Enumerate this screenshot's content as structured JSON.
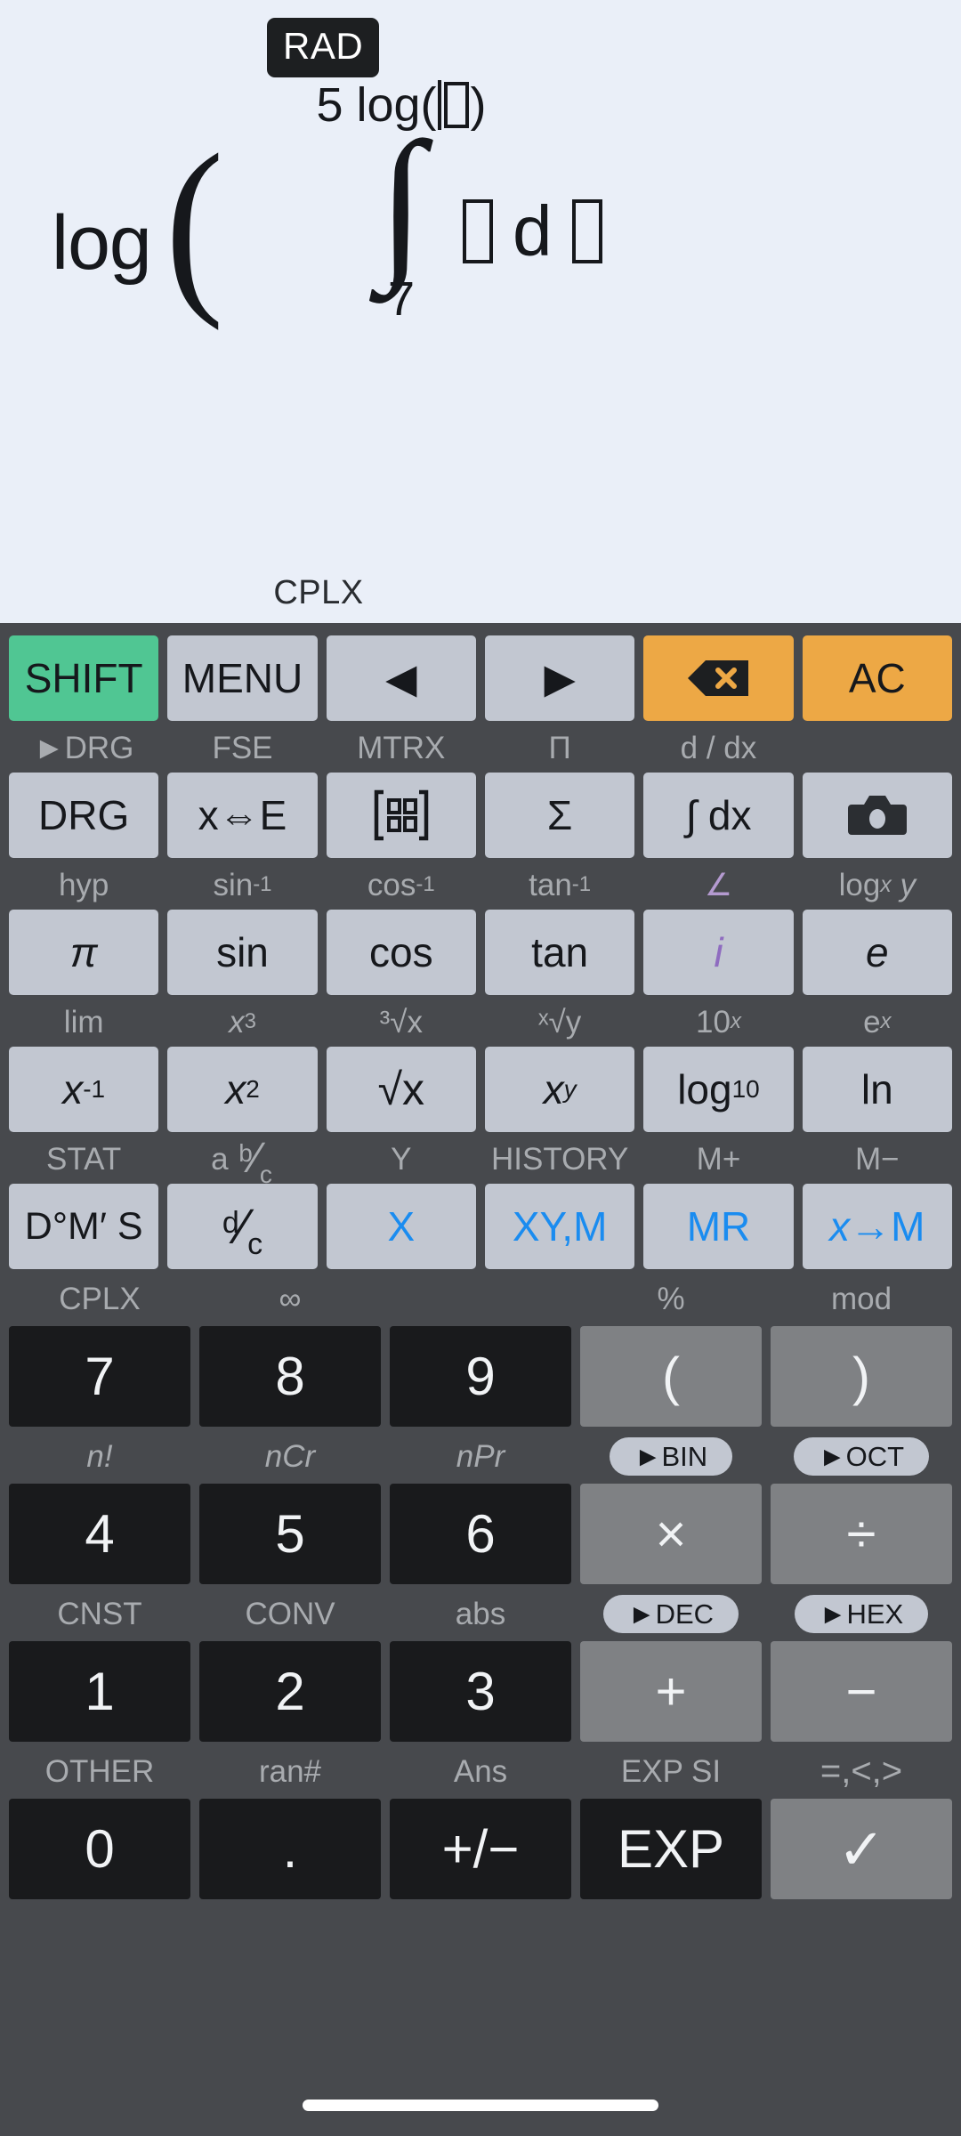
{
  "display": {
    "angle_mode_badge": "RAD",
    "formula": {
      "outer_function": "log",
      "open_paren": "(",
      "integral_upper_limit_prefix": "5 log(",
      "integral_upper_limit_suffix": ")",
      "integral_symbol": "∫",
      "integral_lower_limit": "7",
      "differential": "d"
    },
    "mode_note": "CPLX"
  },
  "keypad": {
    "row1": {
      "buttons": [
        {
          "label": "SHIFT",
          "style": "green"
        },
        {
          "label": "MENU",
          "style": "normal"
        },
        {
          "label": "◀",
          "style": "normal"
        },
        {
          "label": "▶",
          "style": "normal"
        },
        {
          "label": "",
          "style": "orange",
          "icon": "backspace-icon"
        },
        {
          "label": "AC",
          "style": "orange"
        }
      ]
    },
    "row2": {
      "labels": [
        "►DRG",
        "FSE",
        "MTRX",
        "Π",
        "d / dx",
        ""
      ],
      "buttons": [
        {
          "label": "DRG"
        },
        {
          "label": "x⇔E"
        },
        {
          "label": "",
          "icon": "matrix-icon"
        },
        {
          "label": "Σ"
        },
        {
          "label": "∫ dx"
        },
        {
          "label": "",
          "icon": "camera-icon"
        }
      ]
    },
    "row3": {
      "labels": [
        "hyp",
        "sin",
        "cos",
        "tan",
        "∠",
        "log"
      ],
      "label_sups": [
        "",
        "-1",
        "-1",
        "-1",
        "",
        ""
      ],
      "label_extra": [
        "",
        "",
        "",
        "",
        "",
        "x y"
      ],
      "buttons": [
        {
          "label": "π"
        },
        {
          "label": "sin"
        },
        {
          "label": "cos"
        },
        {
          "label": "tan"
        },
        {
          "label": "i"
        },
        {
          "label": "e"
        }
      ]
    },
    "row4": {
      "labels": [
        "lim",
        "x",
        "³√x",
        "ˣ√y",
        "10",
        "e"
      ],
      "label_sups": [
        "",
        "3",
        "",
        "",
        "x",
        "x"
      ],
      "buttons": [
        {
          "label": "x",
          "sup": "-1"
        },
        {
          "label": "x",
          "sup": "2"
        },
        {
          "label": "√x"
        },
        {
          "label": "x",
          "sup": "y"
        },
        {
          "label": "log",
          "sub": "10"
        },
        {
          "label": "ln"
        }
      ]
    },
    "row5": {
      "labels": [
        "STAT",
        "a b/c",
        "Y",
        "HISTORY",
        "M+",
        "M−"
      ],
      "buttons": [
        {
          "label": "D°M′ S"
        },
        {
          "label": "d/c"
        },
        {
          "label": "X",
          "style": "blue"
        },
        {
          "label": "XY,M",
          "style": "blue"
        },
        {
          "label": "MR",
          "style": "blue"
        },
        {
          "label": "x→M",
          "style": "blue"
        }
      ]
    }
  },
  "numpad": {
    "rows": [
      {
        "labels": [
          "CPLX",
          "∞",
          "",
          "%",
          "mod"
        ],
        "label_pills": [
          false,
          false,
          false,
          false,
          false
        ],
        "buttons": [
          {
            "label": "7",
            "style": "dark"
          },
          {
            "label": "8",
            "style": "dark"
          },
          {
            "label": "9",
            "style": "dark"
          },
          {
            "label": "(",
            "style": "gray"
          },
          {
            "label": ")",
            "style": "gray"
          }
        ]
      },
      {
        "labels": [
          "n!",
          "nCr",
          "nPr",
          "►BIN",
          "►OCT"
        ],
        "label_pills": [
          false,
          false,
          false,
          true,
          true
        ],
        "buttons": [
          {
            "label": "4",
            "style": "dark"
          },
          {
            "label": "5",
            "style": "dark"
          },
          {
            "label": "6",
            "style": "dark"
          },
          {
            "label": "×",
            "style": "gray"
          },
          {
            "label": "÷",
            "style": "gray"
          }
        ]
      },
      {
        "labels": [
          "CNST",
          "CONV",
          "abs",
          "►DEC",
          "►HEX"
        ],
        "label_pills": [
          false,
          false,
          false,
          true,
          true
        ],
        "buttons": [
          {
            "label": "1",
            "style": "dark"
          },
          {
            "label": "2",
            "style": "dark"
          },
          {
            "label": "3",
            "style": "dark"
          },
          {
            "label": "+",
            "style": "gray"
          },
          {
            "label": "−",
            "style": "gray"
          }
        ]
      },
      {
        "labels": [
          "OTHER",
          "ran#",
          "Ans",
          "EXP SI",
          "=,<,>"
        ],
        "label_pills": [
          false,
          false,
          false,
          false,
          false
        ],
        "buttons": [
          {
            "label": "0",
            "style": "dark"
          },
          {
            "label": ".",
            "style": "dark"
          },
          {
            "label": "+/−",
            "style": "dark"
          },
          {
            "label": "EXP",
            "style": "dark"
          },
          {
            "label": "✓",
            "style": "gray"
          }
        ]
      }
    ]
  },
  "colors": {
    "display_bg": "#eaeff8",
    "keypad_bg": "#47494d",
    "key_light": "#c2c7d1",
    "key_dark": "#191a1c",
    "key_gray": "#7f8184",
    "accent_green": "#50c693",
    "accent_orange": "#eda845",
    "accent_blue": "#1a8cf0",
    "accent_purple": "#8f6cc0"
  }
}
